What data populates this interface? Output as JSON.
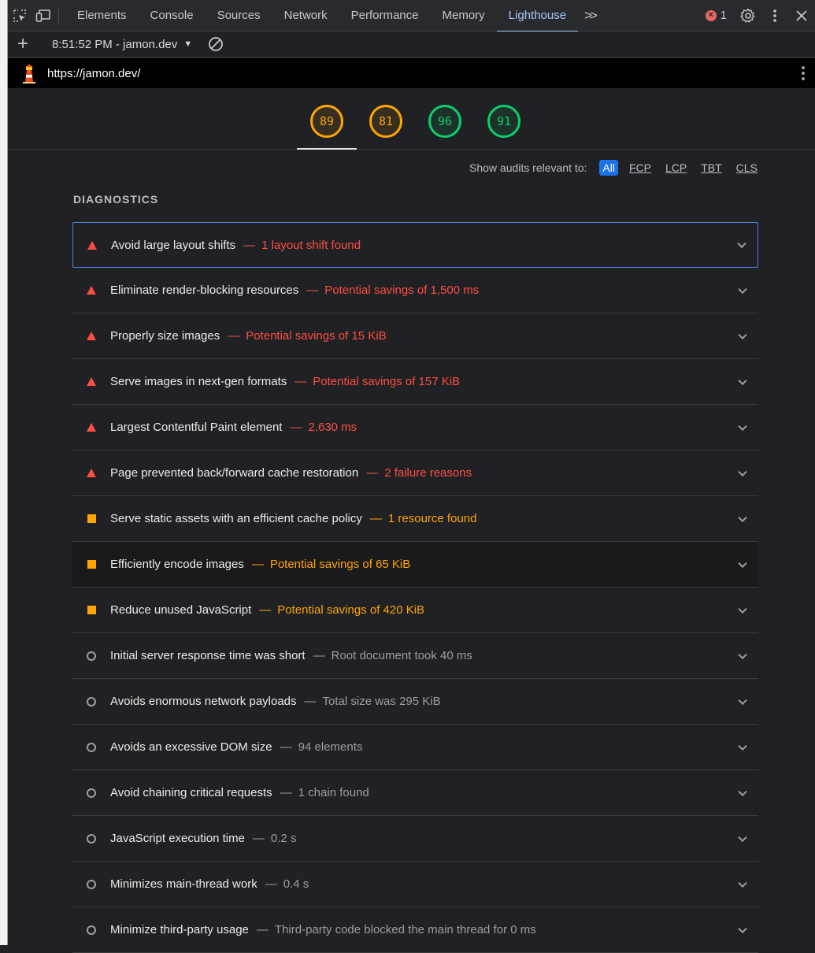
{
  "devtools": {
    "tabs": [
      {
        "label": "Elements",
        "active": false
      },
      {
        "label": "Console",
        "active": false
      },
      {
        "label": "Sources",
        "active": false
      },
      {
        "label": "Network",
        "active": false
      },
      {
        "label": "Performance",
        "active": false
      },
      {
        "label": "Memory",
        "active": false
      },
      {
        "label": "Lighthouse",
        "active": true
      }
    ],
    "error_count": "1"
  },
  "toolbar": {
    "report_label": "8:51:52 PM - jamon.dev"
  },
  "urlbar": {
    "url": "https://jamon.dev/"
  },
  "scores": [
    {
      "value": "89",
      "status": "orange"
    },
    {
      "value": "81",
      "status": "orange"
    },
    {
      "value": "96",
      "status": "green"
    },
    {
      "value": "91",
      "status": "green"
    }
  ],
  "filter": {
    "label": "Show audits relevant to:",
    "options": [
      "All",
      "FCP",
      "LCP",
      "TBT",
      "CLS"
    ],
    "selected": "All"
  },
  "diagnostics": {
    "title": "DIAGNOSTICS",
    "audits": [
      {
        "title": "Avoid large layout shifts",
        "detail": "1 layout shift found",
        "severity": "fail"
      },
      {
        "title": "Eliminate render-blocking resources",
        "detail": "Potential savings of 1,500 ms",
        "severity": "fail"
      },
      {
        "title": "Properly size images",
        "detail": "Potential savings of 15 KiB",
        "severity": "fail"
      },
      {
        "title": "Serve images in next-gen formats",
        "detail": "Potential savings of 157 KiB",
        "severity": "fail"
      },
      {
        "title": "Largest Contentful Paint element",
        "detail": "2,630 ms",
        "severity": "fail"
      },
      {
        "title": "Page prevented back/forward cache restoration",
        "detail": "2 failure reasons",
        "severity": "fail"
      },
      {
        "title": "Serve static assets with an efficient cache policy",
        "detail": "1 resource found",
        "severity": "average"
      },
      {
        "title": "Efficiently encode images",
        "detail": "Potential savings of 65 KiB",
        "severity": "average"
      },
      {
        "title": "Reduce unused JavaScript",
        "detail": "Potential savings of 420 KiB",
        "severity": "average"
      },
      {
        "title": "Initial server response time was short",
        "detail": "Root document took 40 ms",
        "severity": "info"
      },
      {
        "title": "Avoids enormous network payloads",
        "detail": "Total size was 295 KiB",
        "severity": "info"
      },
      {
        "title": "Avoids an excessive DOM size",
        "detail": "94 elements",
        "severity": "info"
      },
      {
        "title": "Avoid chaining critical requests",
        "detail": "1 chain found",
        "severity": "info"
      },
      {
        "title": "JavaScript execution time",
        "detail": "0.2 s",
        "severity": "info"
      },
      {
        "title": "Minimizes main-thread work",
        "detail": "0.4 s",
        "severity": "info"
      },
      {
        "title": "Minimize third-party usage",
        "detail": "Third-party code blocked the main thread for 0 ms",
        "severity": "info"
      }
    ]
  }
}
